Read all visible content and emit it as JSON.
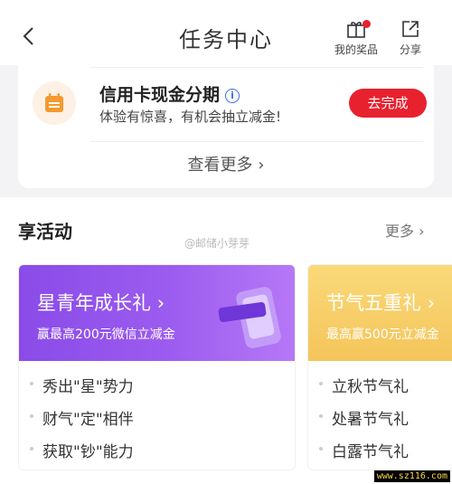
{
  "header": {
    "title": "任务中心",
    "prizes_label": "我的奖品",
    "share_label": "分享"
  },
  "task": {
    "title": "信用卡现金分期",
    "description": "体验有惊喜，有机会抽立减金!",
    "action_label": "去完成",
    "see_more": "查看更多"
  },
  "activities": {
    "section_title": "享活动",
    "more_label": "更多",
    "watermark": "@邮储小芽芽",
    "cards": [
      {
        "title": "星青年成长礼",
        "subtitle": "赢最高200元微信立减金",
        "items": [
          "秀出\"星\"势力",
          "财气\"定\"相伴",
          "获取\"钞\"能力"
        ]
      },
      {
        "title": "节气五重礼",
        "subtitle": "最高赢500元立减金",
        "items": [
          "立秋节气礼",
          "处暑节气礼",
          "白露节气礼"
        ]
      }
    ]
  },
  "site_tag": "www.sz116.com",
  "colors": {
    "accent_red": "#e8212e",
    "purple_banner": "#8a4be8",
    "gold_banner": "#f4c55a"
  }
}
